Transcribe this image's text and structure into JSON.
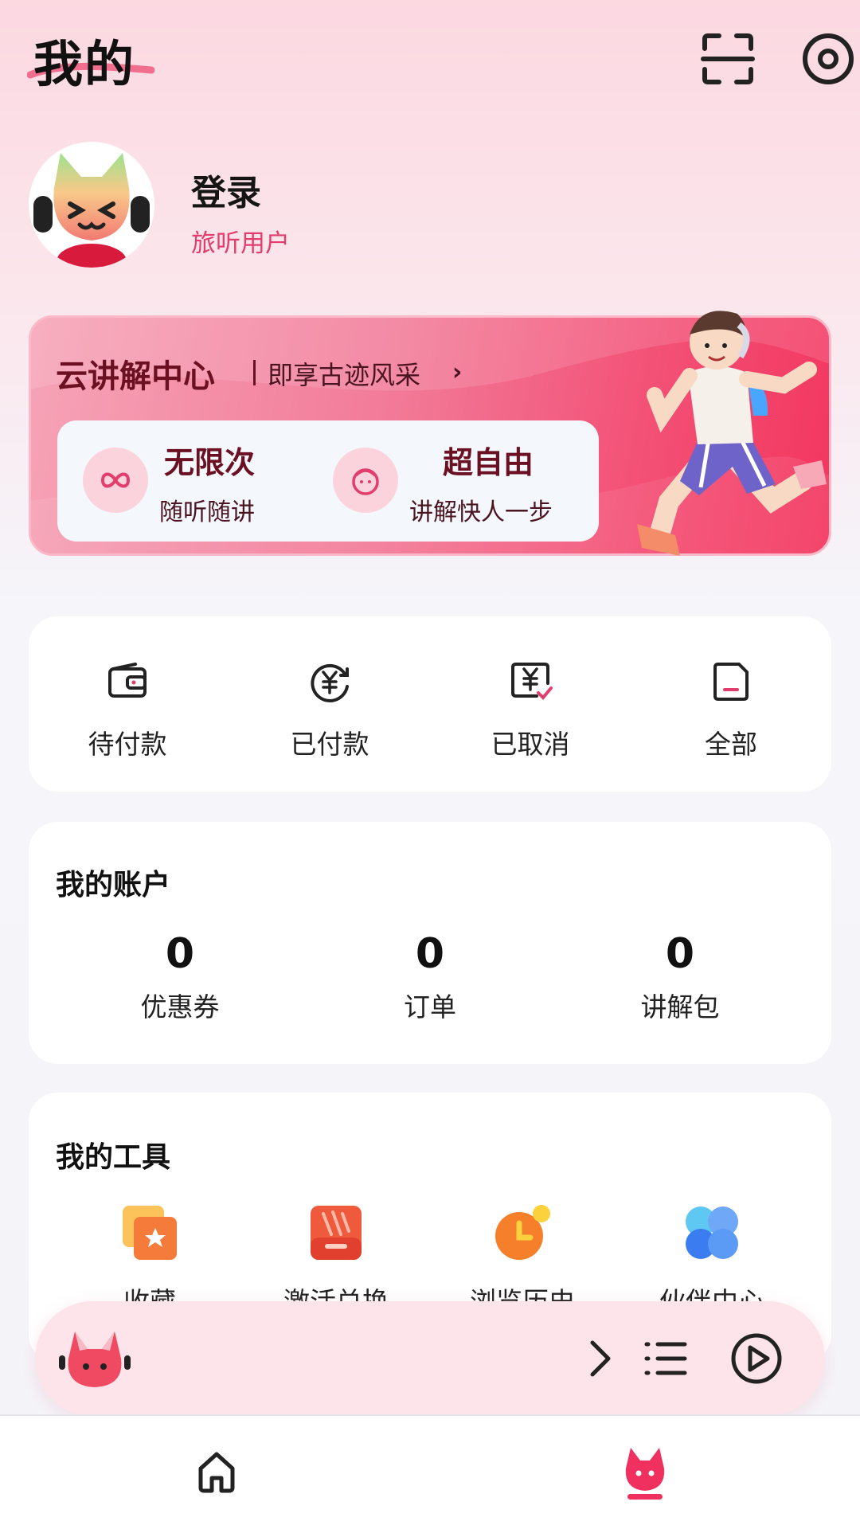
{
  "header": {
    "title": "我的",
    "scan_icon": "scan-icon",
    "settings_icon": "settings-icon"
  },
  "profile": {
    "login_label": "登录",
    "user_type": "旅听用户"
  },
  "banner": {
    "title": "云讲解中心",
    "subtitle": "即享古迹风采",
    "features": [
      {
        "title": "无限次",
        "subtitle": "随听随讲",
        "icon": "infinity-icon"
      },
      {
        "title": "超自由",
        "subtitle": "讲解快人一步",
        "icon": "face-icon"
      }
    ]
  },
  "orders": [
    {
      "label": "待付款",
      "icon": "wallet-icon"
    },
    {
      "label": "已付款",
      "icon": "paid-icon"
    },
    {
      "label": "已取消",
      "icon": "cancelled-icon"
    },
    {
      "label": "全部",
      "icon": "all-orders-icon"
    }
  ],
  "account": {
    "title": "我的账户",
    "stats": [
      {
        "value": "0",
        "label": "优惠券"
      },
      {
        "value": "0",
        "label": "订单"
      },
      {
        "value": "0",
        "label": "讲解包"
      }
    ]
  },
  "tools": {
    "title": "我的工具",
    "items": [
      {
        "label": "收藏",
        "icon": "favorite-icon"
      },
      {
        "label": "激活兑换",
        "icon": "activate-icon"
      },
      {
        "label": "浏览历史",
        "icon": "history-icon"
      },
      {
        "label": "伙伴中心",
        "icon": "partner-icon"
      }
    ]
  },
  "player": {
    "icons": [
      "chevron-right-icon",
      "playlist-icon",
      "play-icon"
    ]
  },
  "nav": {
    "items": [
      "home-icon",
      "mine-icon"
    ],
    "active": "mine-icon",
    "accent": "#f0305e"
  }
}
